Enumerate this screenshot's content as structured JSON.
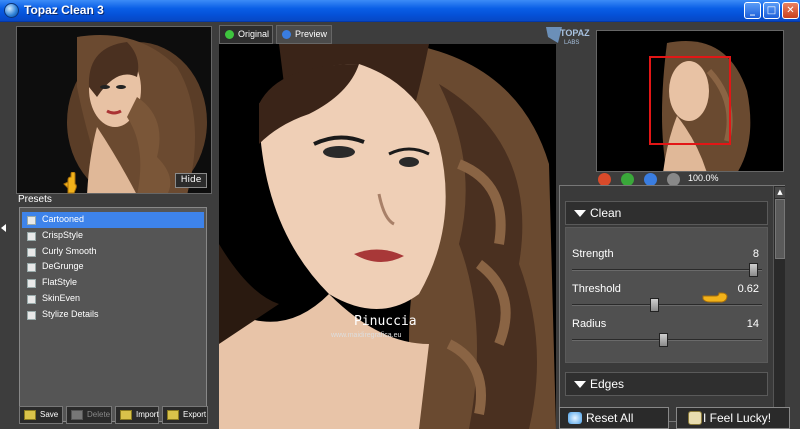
{
  "window": {
    "title": "Topaz Clean 3",
    "buttons": {
      "minimize": "_",
      "maximize": "□",
      "close": "✕"
    }
  },
  "left_panel": {
    "hide_label": "Hide",
    "presets_label": "Presets",
    "presets": [
      {
        "label": "Cartooned",
        "selected": true
      },
      {
        "label": "CrispStyle",
        "selected": false
      },
      {
        "label": "Curly Smooth",
        "selected": false
      },
      {
        "label": "DeGrunge",
        "selected": false
      },
      {
        "label": "FlatStyle",
        "selected": false
      },
      {
        "label": "SkinEven",
        "selected": false
      },
      {
        "label": "Stylize Details",
        "selected": false
      }
    ],
    "actions": {
      "save": "Save",
      "delete": "Delete",
      "import": "Import",
      "export": "Export"
    }
  },
  "center_panel": {
    "tabs": [
      {
        "label": "Original",
        "active": false,
        "dot_color": "#3ec43e"
      },
      {
        "label": "Preview",
        "active": true,
        "dot_color": "#3a7de0"
      }
    ],
    "watermark_name": "Pinuccia",
    "watermark_url": "www.maidiregrafica.eu",
    "brand_logo": "TOPAZ LABS"
  },
  "navigator": {
    "zoom_level": "100.0%",
    "zoom_buttons": [
      {
        "icon": "zoom-out-icon",
        "color": "#d84a2a"
      },
      {
        "icon": "zoom-in-icon",
        "color": "#3aa83a"
      },
      {
        "icon": "fit-icon",
        "color": "#3a7de0"
      },
      {
        "icon": "actual-size-icon",
        "color": "#888888"
      }
    ]
  },
  "settings": {
    "clean_section": {
      "title": "Clean",
      "params": [
        {
          "label": "Strength",
          "value": "8",
          "fraction": 0.98
        },
        {
          "label": "Threshold",
          "value": "0.62",
          "fraction": 0.43
        },
        {
          "label": "Radius",
          "value": "14",
          "fraction": 0.48
        }
      ]
    },
    "edges_section": {
      "title": "Edges"
    }
  },
  "footer": {
    "reset_label": "Reset All",
    "lucky_label": "I Feel Lucky!"
  },
  "colors": {
    "selection": "#3e83ea",
    "titlebar": "#0a5fe6",
    "nav_rect": "#e21616",
    "pointer": "#f2b21a"
  }
}
